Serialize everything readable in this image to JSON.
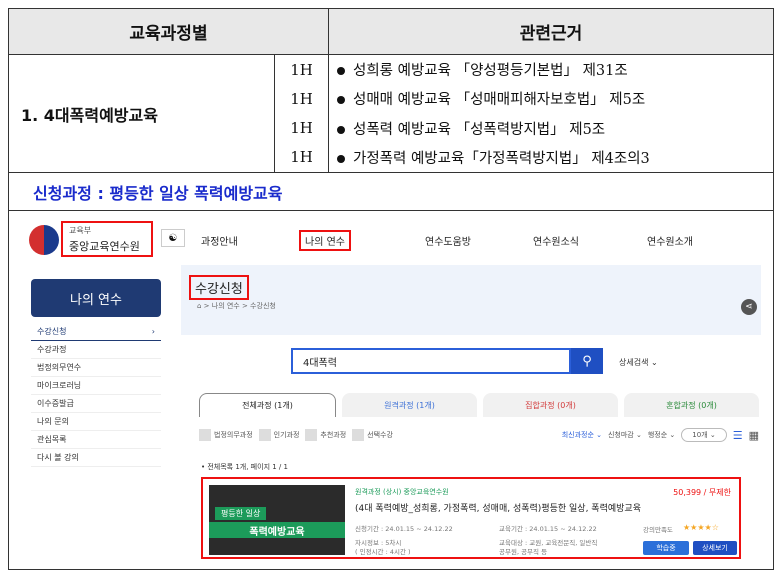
{
  "table": {
    "header": {
      "col1": "교육과정별",
      "col2": "관련근거"
    },
    "row": {
      "label": "1. 4대폭력예방교육",
      "hours": [
        "1H",
        "1H",
        "1H",
        "1H"
      ],
      "laws": [
        "성희롱 예방교육 「양성평등기본법」 제31조",
        "성매매 예방교육 「성매매피해자보호법」 제5조",
        "성폭력 예방교육 「성폭력방지법」 제5조",
        "가정폭력 예방교육「가정폭력방지법」 제4조의3"
      ]
    },
    "apply_text": "신청과정 : 평등한 일상 폭력예방교육"
  },
  "site": {
    "logo_sub": "교육부",
    "logo_title": "중앙교육연수원",
    "nav": [
      "과정안내",
      "나의 연수",
      "연수도움방",
      "연수원소식",
      "연수원소개"
    ],
    "side_head": "나의 연수",
    "side_items": [
      "수강신청",
      "수강과정",
      "법정의무연수",
      "마이크로러닝",
      "이수증발급",
      "나의 문의",
      "관심목록",
      "다시 볼 강의"
    ],
    "page_title": "수강신청",
    "breadcrumb": "⌂  >  나의 연수  >  수강신청",
    "search_value": "4대폭력",
    "advanced_search": "상세검색 ⌄",
    "tabs": [
      "전체과정 (1개)",
      "원격과정 (1개)",
      "집합과정 (0개)",
      "혼합과정 (0개)"
    ],
    "filters": [
      "법정의무과정",
      "인기과정",
      "추천과정",
      "선택수강"
    ],
    "sort_options": [
      "최신과정순 ⌄",
      "신청마감 ⌄",
      "행정순 ⌄",
      "10개 ⌄"
    ],
    "count_text": "• 전체목록 1개, 페이지 1 / 1",
    "card": {
      "tag": "원격과정 (상시) 중앙교육연수원",
      "price": "50,399 / 무제한",
      "title": "(4대 폭력예방_성희롱, 가정폭력, 성매매, 성폭력)평등한 일상, 폭력예방교육",
      "thumb_line1": "평등한 일상",
      "thumb_line2": "폭력예방교육",
      "apply_period": "신청기간 : 24.01.15 ~ 24.12.22",
      "edu_period": "교육기간 : 24.01.15 ~ 24.12.22",
      "satisfaction": "강의만족도",
      "stars": "★★★★☆",
      "credits": "자시정보 : 5차시",
      "credits2": "( 인정시간 : 4시간 )",
      "target": "교육대상 : 교원, 교육전문직, 일반직",
      "target2": "공무원, 공무직 등",
      "btn_learn": "학습중",
      "btn_detail": "상세보기"
    }
  }
}
